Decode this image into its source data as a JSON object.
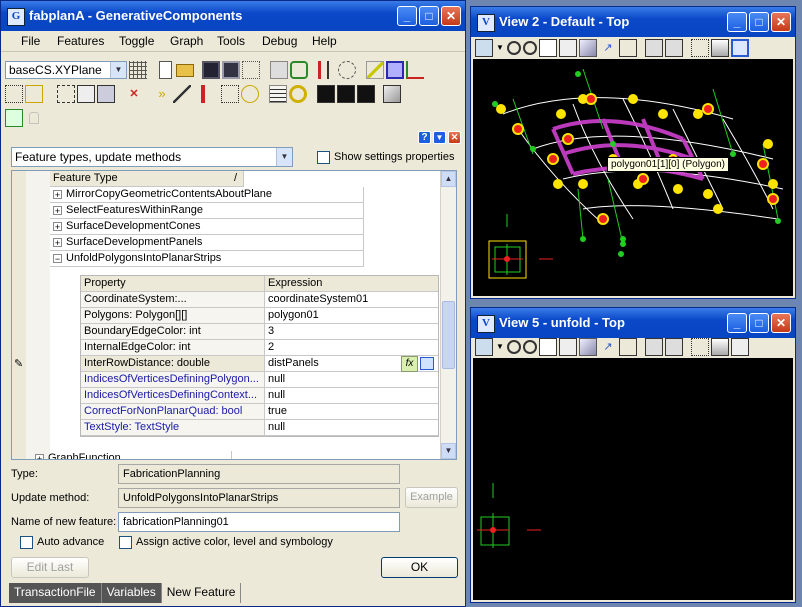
{
  "main_window": {
    "title": "fabplanA - GenerativeComponents",
    "menu": [
      "File",
      "Features",
      "Toggle",
      "Graph",
      "Tools",
      "Debug",
      "Help"
    ],
    "plane_select": "baseCS.XYPlane",
    "feature_types_select": "Feature types, update methods",
    "show_settings_label": "Show settings properties",
    "tree": {
      "header": "Feature Type",
      "sort_indicator": "/",
      "items": [
        "MirrorCopyGeometricContentsAboutPlane",
        "SelectFeaturesWithinRange",
        "SurfaceDevelopmentCones",
        "SurfaceDevelopmentPanels",
        "UnfoldPolygonsIntoPlanarStrips"
      ],
      "partial_item": "GraphFunction",
      "expander_plus": "+",
      "expander_minus": "−"
    },
    "properties": {
      "col_property": "Property",
      "col_expression": "Expression",
      "rows": [
        {
          "property": "CoordinateSystem:...",
          "expression": "coordinateSystem01",
          "blue": false
        },
        {
          "property": "Polygons: Polygon[][]",
          "expression": "polygon01",
          "blue": false
        },
        {
          "property": "BoundaryEdgeColor: int",
          "expression": "3",
          "blue": false
        },
        {
          "property": "InternalEdgeColor: int",
          "expression": "2",
          "blue": false
        },
        {
          "property": "InterRowDistance: double",
          "expression": "distPanels",
          "blue": false
        },
        {
          "property": "IndicesOfVerticesDefiningPolygon...",
          "expression": "null",
          "blue": true
        },
        {
          "property": "IndicesOfVerticesDefiningContext...",
          "expression": "null",
          "blue": true
        },
        {
          "property": "CorrectForNonPlanarQuad: bool",
          "expression": "true",
          "blue": true
        },
        {
          "property": "TextStyle: TextStyle",
          "expression": "null",
          "blue": true
        }
      ],
      "fx_label": "fx"
    },
    "type_label": "Type:",
    "type_value": "FabricationPlanning",
    "update_method_label": "Update method:",
    "update_method_value": "UnfoldPolygonsIntoPlanarStrips",
    "example_button": "Example",
    "name_label": "Name of new feature:",
    "name_value": "fabricationPlanning01",
    "auto_advance_label": "Auto advance",
    "assign_label": "Assign active color, level and symbology",
    "edit_last_button": "Edit Last",
    "ok_button": "OK",
    "tabs": [
      "TransactionFile",
      "Variables",
      "New Feature"
    ],
    "help_glyph": "?",
    "down_glyph": "▼",
    "close_glyph": "✕"
  },
  "view2": {
    "title": "View 2 - Default - Top",
    "tooltip": "polygon01[1][0] (Polygon)"
  },
  "view5": {
    "title": "View 5 - unfold - Top"
  },
  "titlebar_buttons": {
    "minimize": "_",
    "maximize": "□",
    "close": "✕"
  }
}
